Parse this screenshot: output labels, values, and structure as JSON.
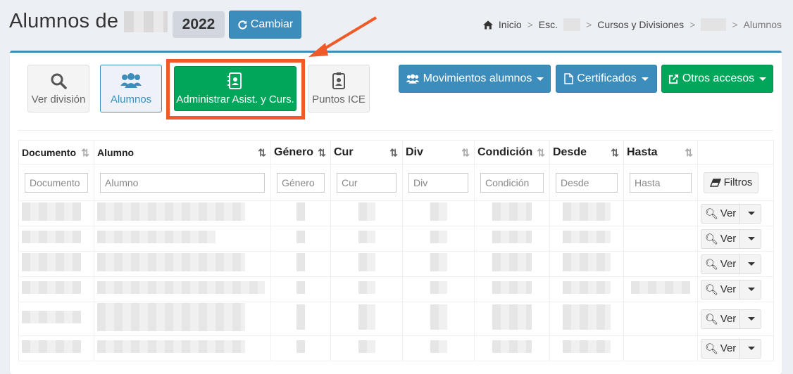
{
  "header": {
    "title_prefix": "Alumnos de",
    "title_dash": "-",
    "year": "2022",
    "cambiar_label": "Cambiar"
  },
  "breadcrumb": {
    "inicio": "Inicio",
    "esc": "Esc.",
    "cursos": "Cursos y Divisiones",
    "alumnos": "Alumnos",
    "separator": ">"
  },
  "toolbar": {
    "ver_division": "Ver división",
    "alumnos": "Alumnos",
    "administrar": "Administrar Asist. y Curs.",
    "puntos_ice": "Puntos ICE",
    "movimientos": "Movimientos alumnos",
    "certificados": "Certificados",
    "otros_accesos": "Otros accesos"
  },
  "table": {
    "columns": [
      "Documento",
      "Alumno",
      "Género",
      "Cur",
      "Div",
      "Condición",
      "Desde",
      "Hasta"
    ],
    "placeholders": {
      "documento": "Documento",
      "alumno": "Alumno",
      "genero": "Género",
      "cur": "Cur",
      "div": "Div",
      "condicion": "Condición",
      "desde": "Desde",
      "hasta": "Hasta"
    },
    "filtros_label": "Filtros",
    "ver_label": "Ver"
  },
  "colors": {
    "primary": "#3c8dbc",
    "success": "#00a65a",
    "annotation": "#f05a28",
    "background": "#ecf0f5"
  }
}
